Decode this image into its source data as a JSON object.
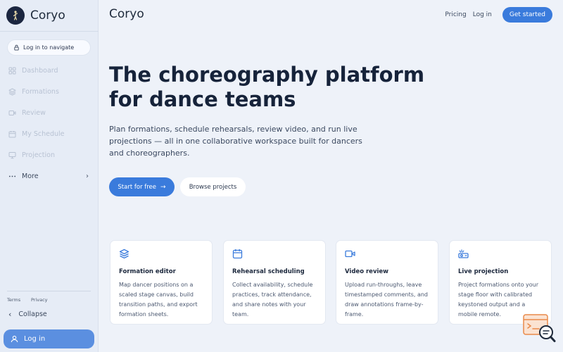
{
  "sidebar": {
    "brand_name": "Coryo",
    "login_nav_label": "Log in to navigate",
    "items": [
      {
        "label": "Dashboard",
        "icon": "grid-icon"
      },
      {
        "label": "Formations",
        "icon": "layers-icon"
      },
      {
        "label": "Review",
        "icon": "video-icon"
      },
      {
        "label": "My Schedule",
        "icon": "calendar-icon"
      },
      {
        "label": "Projection",
        "icon": "monitor-icon"
      },
      {
        "label": "More",
        "icon": "more-icon"
      }
    ],
    "terms": "Terms",
    "privacy": "Privacy",
    "collapse_label": "Collapse",
    "login_label": "Log in"
  },
  "header": {
    "title": "Coryo",
    "pricing": "Pricing",
    "login": "Log in",
    "get_started": "Get started"
  },
  "hero": {
    "title": "The choreography platform for dance teams",
    "subtitle": "Plan formations, schedule rehearsals, review video, and run live projections — all in one collaborative workspace built for dancers and choreographers.",
    "primary_cta": "Start for free",
    "secondary_cta": "Browse projects"
  },
  "features": [
    {
      "title": "Formation editor",
      "desc": "Map dancer positions on a scaled stage canvas, build transition paths, and export formation sheets.",
      "icon": "layers-icon"
    },
    {
      "title": "Rehearsal scheduling",
      "desc": "Collect availability, schedule practices, track attendance, and share notes with your team.",
      "icon": "calendar-icon"
    },
    {
      "title": "Video review",
      "desc": "Upload run-throughs, leave timestamped comments, and draw annotations frame-by-frame.",
      "icon": "video-icon"
    },
    {
      "title": "Live projection",
      "desc": "Project formations onto your stage floor with calibrated keystoned output and a mobile remote.",
      "icon": "projector-icon"
    }
  ],
  "colors": {
    "accent": "#3a7bdc",
    "sidebar_bg": "#e6ecf6",
    "page_bg": "#eef2f9",
    "login_button": "#5b8fe0"
  }
}
